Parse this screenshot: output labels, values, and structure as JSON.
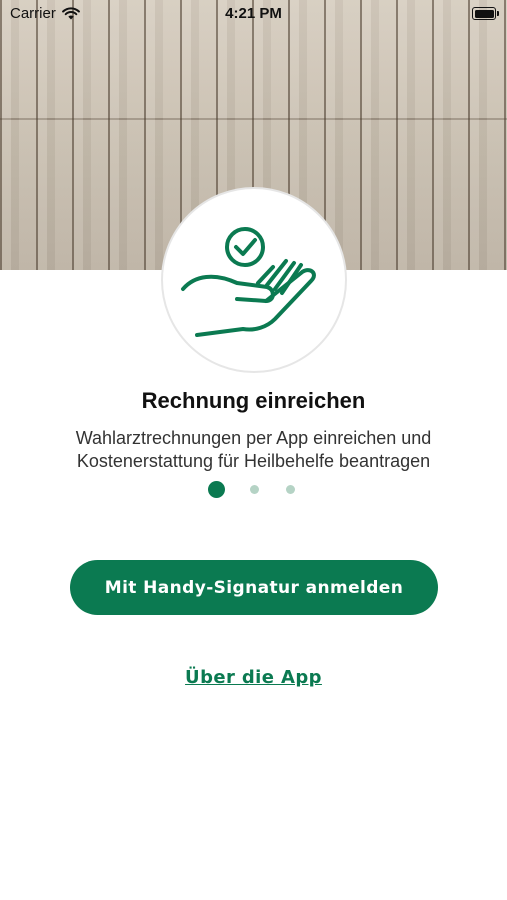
{
  "status_bar": {
    "carrier": "Carrier",
    "time": "4:21 PM",
    "icons": [
      "wifi-icon",
      "battery-icon"
    ]
  },
  "onboarding": {
    "illustration_icon": "hand-with-checkmark-icon",
    "title": "Rechnung einreichen",
    "subtitle_line1": "Wahlarztrechnungen per App einreichen und",
    "subtitle_line2": "Kostenerstattung für Heilbehelfe beantragen",
    "page_indicator": {
      "total": 3,
      "current": 1
    }
  },
  "actions": {
    "primary_label": "Mit Handy-Signatur anmelden",
    "secondary_label": "Über die App"
  },
  "colors": {
    "accent": "#0b7a51",
    "dot_inactive": "#b5d3c5",
    "text": "#111111",
    "background": "#ffffff"
  }
}
